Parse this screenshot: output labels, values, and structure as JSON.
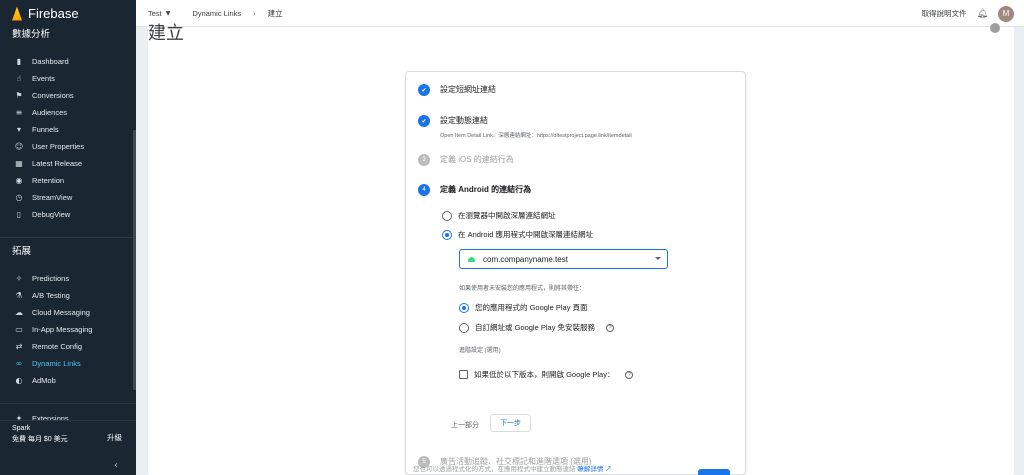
{
  "app": {
    "name": "Firebase"
  },
  "sidebar": {
    "analytics_title": "數據分析",
    "analytics_items": [
      {
        "label": "Dashboard",
        "icon": "bar-chart-icon",
        "glyph": "▮"
      },
      {
        "label": "Events",
        "icon": "touch-icon",
        "glyph": "☝"
      },
      {
        "label": "Conversions",
        "icon": "flag-icon",
        "glyph": "⚑"
      },
      {
        "label": "Audiences",
        "icon": "audience-icon",
        "glyph": "≡"
      },
      {
        "label": "Funnels",
        "icon": "funnel-icon",
        "glyph": "▾"
      },
      {
        "label": "User Properties",
        "icon": "person-icon",
        "glyph": "☺"
      },
      {
        "label": "Latest Release",
        "icon": "release-icon",
        "glyph": "▦"
      },
      {
        "label": "Retention",
        "icon": "retention-icon",
        "glyph": "◉"
      },
      {
        "label": "StreamView",
        "icon": "clock-icon",
        "glyph": "◷"
      },
      {
        "label": "DebugView",
        "icon": "phone-icon",
        "glyph": "▯"
      }
    ],
    "grow_title": "拓展",
    "grow_items": [
      {
        "label": "Predictions",
        "icon": "wand-icon",
        "glyph": "✧"
      },
      {
        "label": "A/B Testing",
        "icon": "flask-icon",
        "glyph": "⚗"
      },
      {
        "label": "Cloud Messaging",
        "icon": "cloud-icon",
        "glyph": "☁"
      },
      {
        "label": "In-App Messaging",
        "icon": "message-icon",
        "glyph": "▭"
      },
      {
        "label": "Remote Config",
        "icon": "config-icon",
        "glyph": "⇄"
      },
      {
        "label": "Dynamic Links",
        "icon": "link-icon",
        "glyph": "∞",
        "active": true
      },
      {
        "label": "AdMob",
        "icon": "admob-icon",
        "glyph": "◐"
      }
    ],
    "extensions": {
      "label": "Extensions",
      "icon": "extensions-icon",
      "glyph": "✦"
    },
    "plan": {
      "name": "Spark",
      "desc": "免費 每月 $0 美元",
      "upgrade": "升級"
    },
    "collapse_glyph": "‹"
  },
  "topbar": {
    "project": "Test",
    "section": "Dynamic Links",
    "page": "建立",
    "docs": "取得說明文件",
    "avatar": "M"
  },
  "main": {
    "title": "建立",
    "steps": [
      {
        "title": "設定短網址連結"
      },
      {
        "title": "設定動態連結",
        "subtitle": "Open Item Detail Link。深層連結網址：https://dltestproject.page.link/itemdetail"
      },
      {
        "num": "3",
        "title": "定義 iOS 的連結行為"
      },
      {
        "num": "4",
        "title": "定義 Android 的連結行為"
      },
      {
        "num": "5",
        "title": "廣告活動追蹤、社交標記和進階選項 (選用)"
      }
    ],
    "android": {
      "option_browser": "在瀏覽器中開啟深層連結網址",
      "option_app": "在 Android 應用程式中開啟深層連結網址",
      "package": "com.companyname.test",
      "not_installed_label": "如果使用者未安裝您的應用程式，則將其帶往：",
      "option_play": "您的應用程式的 Google Play 頁面",
      "option_custom": "自訂網址或 Google Play 免安裝服務",
      "advanced_label": "進階設定 (選用)",
      "min_version_label": "如果低於以下版本，則開啟 Google Play：",
      "prev": "上一部分",
      "next": "下一步"
    },
    "footer_text": "您也可以透過程式化的方式，在應用程式中建立動態連結",
    "footer_link": "瞭解詳情"
  },
  "colors": {
    "accent": "#1a73e8",
    "sidebar": "#1a2733",
    "active_nav": "#4fc3f7"
  }
}
